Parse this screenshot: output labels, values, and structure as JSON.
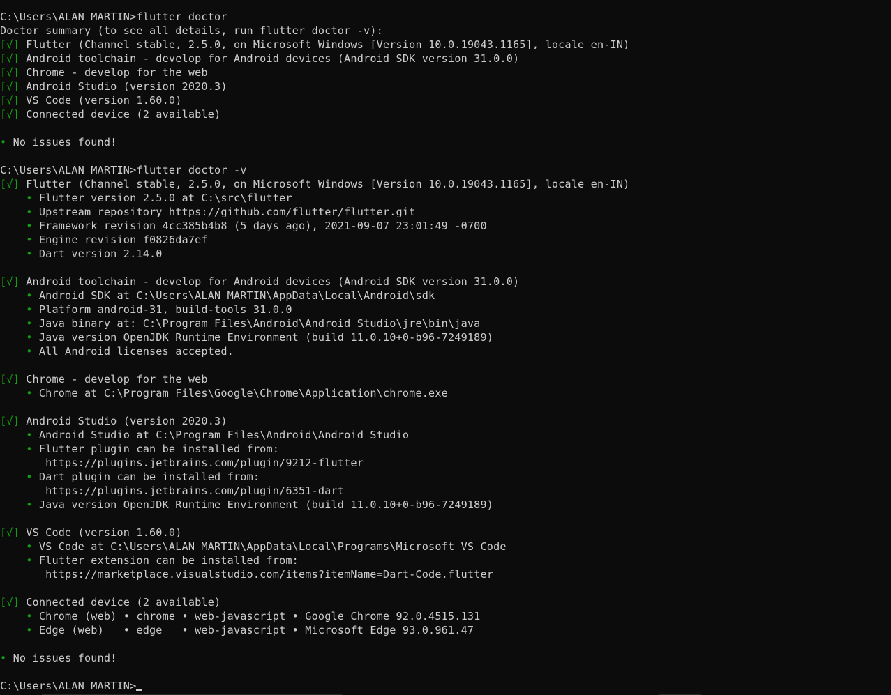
{
  "terminal": {
    "lines": [
      {
        "prompt": "C:\\Users\\ALAN MARTIN>",
        "cmd": "flutter doctor"
      },
      {
        "text": "Doctor summary (to see all details, run flutter doctor -v):"
      },
      {
        "check": "[√]",
        "text": " Flutter (Channel stable, 2.5.0, on Microsoft Windows [Version 10.0.19043.1165], locale en-IN)"
      },
      {
        "check": "[√]",
        "text": " Android toolchain - develop for Android devices (Android SDK version 31.0.0)"
      },
      {
        "check": "[√]",
        "text": " Chrome - develop for the web"
      },
      {
        "check": "[√]",
        "text": " Android Studio (version 2020.3)"
      },
      {
        "check": "[√]",
        "text": " VS Code (version 1.60.0)"
      },
      {
        "check": "[√]",
        "text": " Connected device (2 available)"
      },
      {
        "blank": true
      },
      {
        "bullet": "•",
        "indent": "",
        "text": " No issues found!"
      },
      {
        "blank": true
      },
      {
        "prompt": "C:\\Users\\ALAN MARTIN>",
        "cmd": "flutter doctor -v"
      },
      {
        "check": "[√]",
        "text": " Flutter (Channel stable, 2.5.0, on Microsoft Windows [Version 10.0.19043.1165], locale en-IN)"
      },
      {
        "bullet": "•",
        "indent": "    ",
        "text": " Flutter version 2.5.0 at C:\\src\\flutter"
      },
      {
        "bullet": "•",
        "indent": "    ",
        "text": " Upstream repository https://github.com/flutter/flutter.git"
      },
      {
        "bullet": "•",
        "indent": "    ",
        "text": " Framework revision 4cc385b4b8 (5 days ago), 2021-09-07 23:01:49 -0700"
      },
      {
        "bullet": "•",
        "indent": "    ",
        "text": " Engine revision f0826da7ef"
      },
      {
        "bullet": "•",
        "indent": "    ",
        "text": " Dart version 2.14.0"
      },
      {
        "blank": true
      },
      {
        "check": "[√]",
        "text": " Android toolchain - develop for Android devices (Android SDK version 31.0.0)"
      },
      {
        "bullet": "•",
        "indent": "    ",
        "text": " Android SDK at C:\\Users\\ALAN MARTIN\\AppData\\Local\\Android\\sdk"
      },
      {
        "bullet": "•",
        "indent": "    ",
        "text": " Platform android-31, build-tools 31.0.0"
      },
      {
        "bullet": "•",
        "indent": "    ",
        "text": " Java binary at: C:\\Program Files\\Android\\Android Studio\\jre\\bin\\java"
      },
      {
        "bullet": "•",
        "indent": "    ",
        "text": " Java version OpenJDK Runtime Environment (build 11.0.10+0-b96-7249189)"
      },
      {
        "bullet": "•",
        "indent": "    ",
        "text": " All Android licenses accepted."
      },
      {
        "blank": true
      },
      {
        "check": "[√]",
        "text": " Chrome - develop for the web"
      },
      {
        "bullet": "•",
        "indent": "    ",
        "text": " Chrome at C:\\Program Files\\Google\\Chrome\\Application\\chrome.exe"
      },
      {
        "blank": true
      },
      {
        "check": "[√]",
        "text": " Android Studio (version 2020.3)"
      },
      {
        "bullet": "•",
        "indent": "    ",
        "text": " Android Studio at C:\\Program Files\\Android\\Android Studio"
      },
      {
        "bullet": "•",
        "indent": "    ",
        "text": " Flutter plugin can be installed from:"
      },
      {
        "text": "       https://plugins.jetbrains.com/plugin/9212-flutter"
      },
      {
        "bullet": "•",
        "indent": "    ",
        "text": " Dart plugin can be installed from:"
      },
      {
        "text": "       https://plugins.jetbrains.com/plugin/6351-dart"
      },
      {
        "bullet": "•",
        "indent": "    ",
        "text": " Java version OpenJDK Runtime Environment (build 11.0.10+0-b96-7249189)"
      },
      {
        "blank": true
      },
      {
        "check": "[√]",
        "text": " VS Code (version 1.60.0)"
      },
      {
        "bullet": "•",
        "indent": "    ",
        "text": " VS Code at C:\\Users\\ALAN MARTIN\\AppData\\Local\\Programs\\Microsoft VS Code"
      },
      {
        "bullet": "•",
        "indent": "    ",
        "text": " Flutter extension can be installed from:"
      },
      {
        "text": "       https://marketplace.visualstudio.com/items?itemName=Dart-Code.flutter"
      },
      {
        "blank": true
      },
      {
        "check": "[√]",
        "text": " Connected device (2 available)"
      },
      {
        "bullet": "•",
        "indent": "    ",
        "text": " Chrome (web) • chrome • web-javascript • Google Chrome 92.0.4515.131"
      },
      {
        "bullet": "•",
        "indent": "    ",
        "text": " Edge (web)   • edge   • web-javascript • Microsoft Edge 93.0.961.47"
      },
      {
        "blank": true
      },
      {
        "bullet": "•",
        "indent": "",
        "text": " No issues found!"
      },
      {
        "blank": true
      },
      {
        "prompt": "C:\\Users\\ALAN MARTIN>",
        "cmd": "",
        "cursor": true
      }
    ]
  },
  "colors": {
    "background": "#0c0c0c",
    "text": "#cccccc",
    "success": "#13a10e"
  }
}
